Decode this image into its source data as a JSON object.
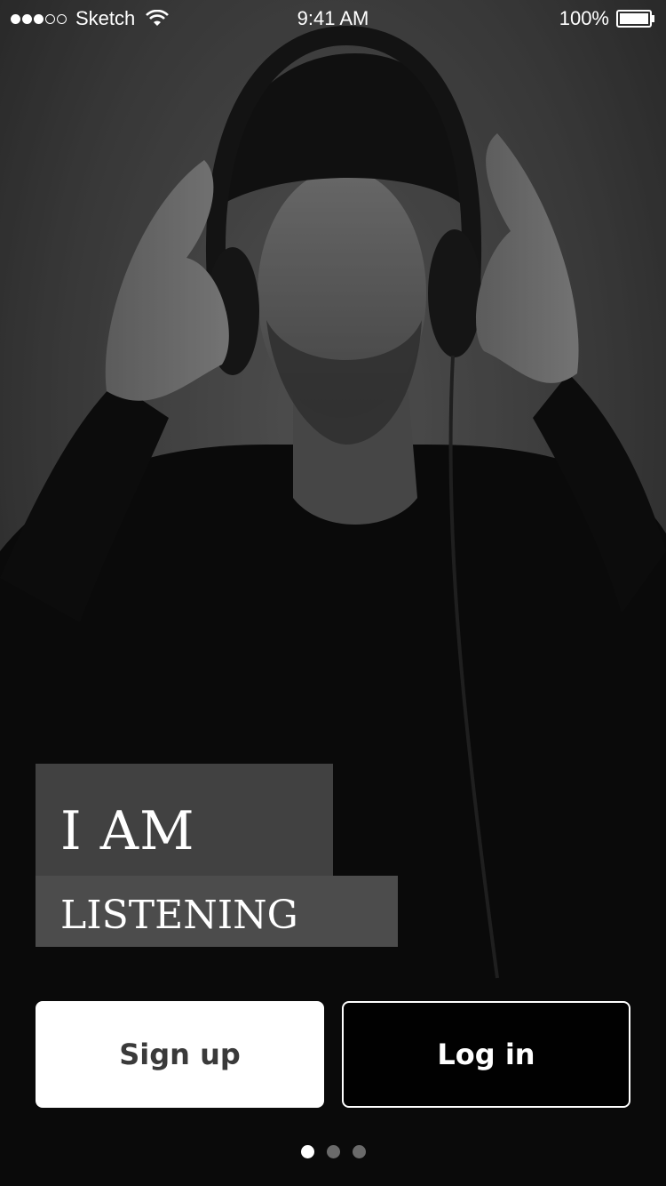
{
  "status_bar": {
    "carrier": "Sketch",
    "time": "9:41 AM",
    "battery": "100%",
    "signal_strength": 3,
    "signal_max": 5
  },
  "hero": {
    "title_line_1": "I AM",
    "title_line_2": "LISTENING",
    "image": "man-with-headphones-photo"
  },
  "actions": {
    "signup_label": "Sign up",
    "login_label": "Log in"
  },
  "pager": {
    "count": 3,
    "active_index": 0
  },
  "colors": {
    "background": "#2a2a2a",
    "signup_bg": "#ffffff",
    "signup_text": "#3a3a3a",
    "login_bg": "#000000",
    "login_border": "#ffffff",
    "title_block": "#464646"
  }
}
